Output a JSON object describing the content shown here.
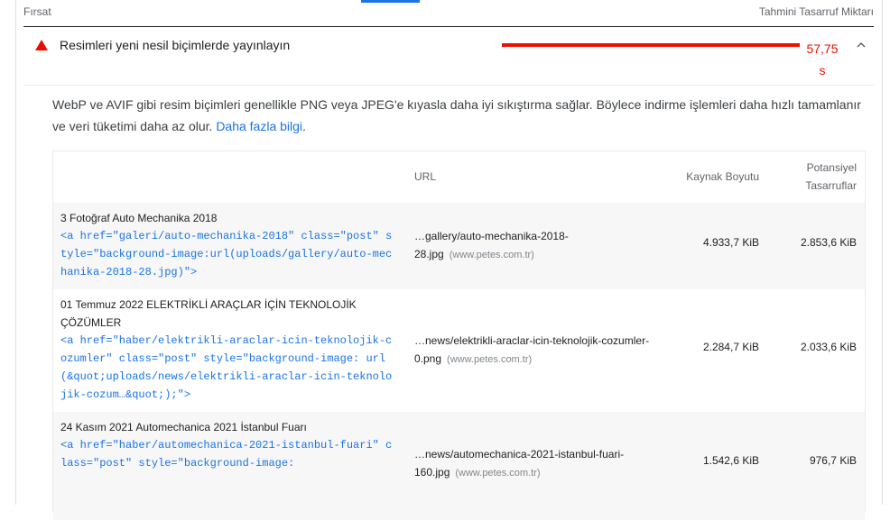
{
  "header": {
    "opportunity": "Fırsat",
    "estimated_savings": "Tahmini Tasarruf Miktarı"
  },
  "audit": {
    "title": "Resimleri yeni nesil biçimlerde yayınlayın",
    "savings_value": "57,75",
    "savings_unit": "s",
    "status_color": "#eb0f00"
  },
  "description": {
    "text": "WebP ve AVIF gibi resim biçimleri genellikle PNG veya JPEG'e kıyasla daha iyi sıkıştırma sağlar. Böylece indirme işlemleri daha hızlı tamamlanır ve veri tüketimi daha az olur. ",
    "link": "Daha fazla bilgi",
    "end": "."
  },
  "table": {
    "headers": {
      "url": "URL",
      "size": "Kaynak Boyutu",
      "savings_line1": "Potansiyel",
      "savings_line2": "Tasarruflar"
    },
    "rows": [
      {
        "node_label": "3 Fotoğraf Auto Mechanika 2018",
        "snippet": "<a href=\"galeri/auto-mechanika-2018\" class=\"post\" style=\"background-image:url(uploads/gallery/auto-mechanika-2018-28.jpg)\">",
        "url": "…gallery/auto-mechanika-2018-28.jpg",
        "host": "(www.petes.com.tr)",
        "size": "4.933,7 KiB",
        "savings": "2.853,6 KiB"
      },
      {
        "node_label": "01 Temmuz 2022 ELEKTRİKLİ ARAÇLAR İÇİN TEKNOLOJİK ÇÖZÜMLER",
        "snippet": "<a href=\"haber/elektrikli-araclar-icin-teknolojik-cozumler\" class=\"post\" style=\"background-image: url(&quot;uploads/news/elektrikli-araclar-icin-teknolojik-cozum…&quot;);\">",
        "url": "…news/elektrikli-araclar-icin-teknolojik-cozumler-0.png",
        "host": "(www.petes.com.tr)",
        "size": "2.284,7 KiB",
        "savings": "2.033,6 KiB"
      },
      {
        "node_label": "24 Kasım 2021 Automechanica 2021 İstanbul Fuarı",
        "snippet": "<a href=\"haber/automechanica-2021-istanbul-fuari\" class=\"post\" style=\"background-image:",
        "url": "…news/automechanica-2021-istanbul-fuari-160.jpg",
        "host": "(www.petes.com.tr)",
        "size": "1.542,6 KiB",
        "savings": "976,7 KiB"
      }
    ]
  }
}
